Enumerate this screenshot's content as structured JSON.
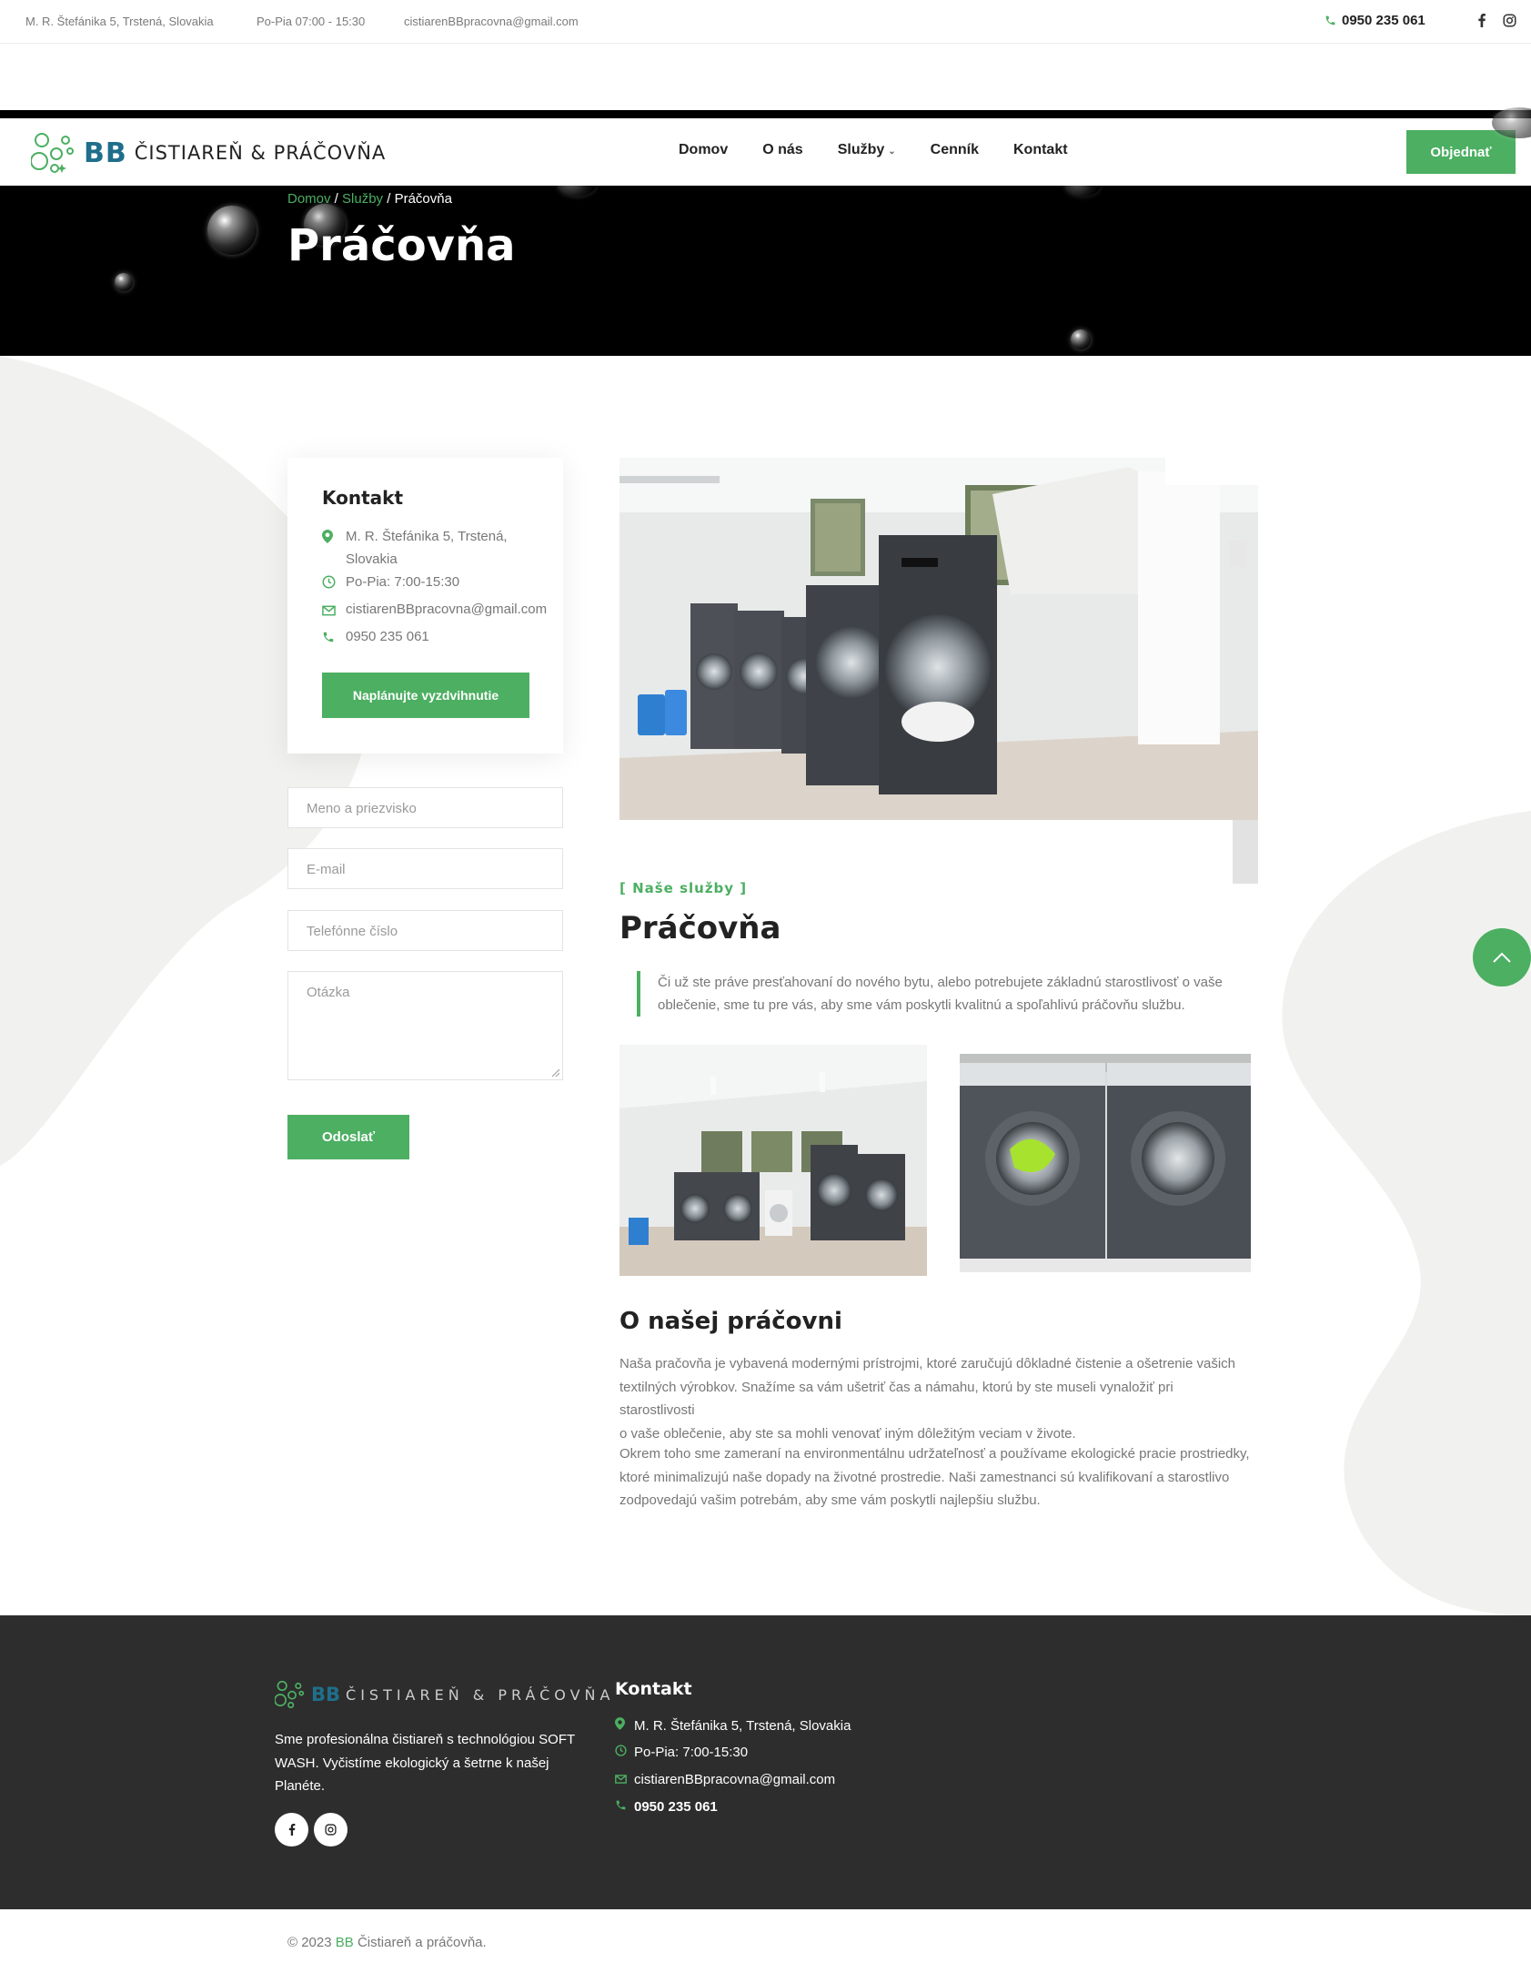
{
  "topbar": {
    "address": "M. R. Štefánika 5, Trstená, Slovakia",
    "hours": "Po-Pia 07:00 - 15:30",
    "email": "cistiarenBBpracovna@gmail.com",
    "phone": "0950 235 061"
  },
  "nav": {
    "logo_bb": "BB",
    "logo_text": "ČISTIAREŇ & PRÁČOVŇA",
    "items": [
      "Domov",
      "O nás",
      "Služby",
      "Cenník",
      "Kontakt"
    ],
    "order_label": "Objednať"
  },
  "hero": {
    "crumb_home": "Domov",
    "crumb_sep": " / ",
    "crumb_services": "Služby",
    "crumb_current": "Práčovňa",
    "title": "Práčovňa"
  },
  "sidebar": {
    "contact_title": "Kontakt",
    "address_line1": "M. R. Štefánika 5, Trstená,",
    "address_line2": "Slovakia",
    "hours": "Po-Pia: 7:00-15:30",
    "email": "cistiarenBBpracovna@gmail.com",
    "phone": "0950 235 061",
    "pickup_label": "Naplánujte vyzdvihnutie",
    "form": {
      "name_placeholder": "Meno a priezvisko",
      "email_placeholder": "E-mail",
      "phone_placeholder": "Telefónne číslo",
      "question_placeholder": "Otázka",
      "submit_label": "Odoslať"
    }
  },
  "content": {
    "tag": "[ Naše služby ]",
    "title": "Práčovňa",
    "quote_line1": "Či už ste práve presťahovaní do nového bytu, alebo potrebujete základnú starostlivosť o vaše",
    "quote_line2": "oblečenie, sme tu pre vás, aby sme vám poskytli kvalitnú a spoľahlivú práčovňu službu.",
    "about_title": "O našej práčovni",
    "para1_line1": "Naša pračovňa je vybavená modernými prístrojmi, ktoré zaručujú dôkladné čistenie a ošetrenie vašich",
    "para1_line2": "textilných výrobkov. Snažíme sa vám ušetriť čas a námahu, ktorú by ste museli vynaložiť pri starostlivosti",
    "para1_line3": "o vaše oblečenie, aby ste sa mohli venovať iným dôležitým veciam v živote.",
    "para2_line1": "Okrem toho sme zameraní na environmentálnu udržateľnosť a používame ekologické pracie prostriedky,",
    "para2_line2": "ktoré minimalizujú naše dopady na životné prostredie. Naši zamestnanci sú kvalifikovaní a starostlivo",
    "para2_line3": "zodpovedajú vašim potrebám, aby sme vám poskytli najlepšiu službu."
  },
  "footer": {
    "logo_bb": "BB",
    "logo_text": "ČISTIAREŇ & PRÁČOVŇA",
    "desc": "Sme profesionálna čistiareň s technológiou SOFT WASH. Vyčistíme ekologický a šetrne k našej Planéte.",
    "contact_title": "Kontakt",
    "address": "M. R. Štefánika 5, Trstená, Slovakia",
    "hours": "Po-Pia: 7:00-15:30",
    "email": "cistiarenBBpracovna@gmail.com",
    "phone": "0950 235 061",
    "copy_prefix": "© 2023 ",
    "copy_bb": "BB",
    "copy_suffix": " Čistiareň a práčovňa."
  },
  "colors": {
    "accent": "#4caf62",
    "brand_blue": "#1f6f8b",
    "dark": "#2d2d2d",
    "hero_bg": "#000000"
  },
  "icons": [
    "phone-icon",
    "facebook-icon",
    "instagram-icon",
    "map-pin-icon",
    "clock-icon",
    "mail-icon",
    "chevron-up-icon"
  ]
}
